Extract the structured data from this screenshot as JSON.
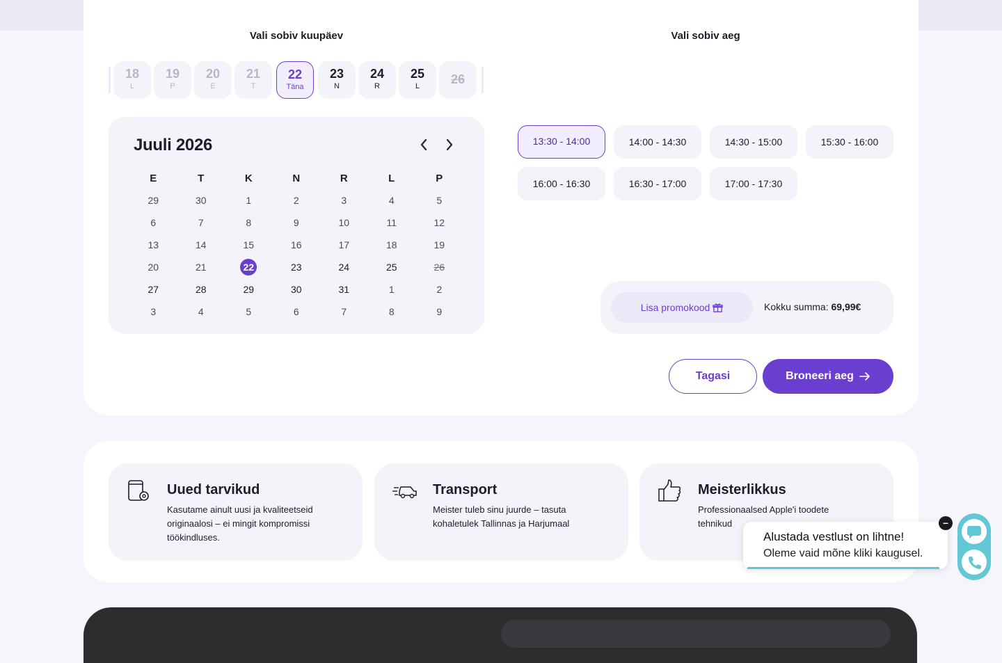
{
  "date_section": {
    "title": "Vali sobiv kuupäev"
  },
  "time_section": {
    "title": "Vali sobiv aeg"
  },
  "date_strip": [
    {
      "num": "18",
      "label": "L",
      "state": "past"
    },
    {
      "num": "19",
      "label": "P",
      "state": "past"
    },
    {
      "num": "20",
      "label": "E",
      "state": "past"
    },
    {
      "num": "21",
      "label": "T",
      "state": "past"
    },
    {
      "num": "22",
      "label": "Täna",
      "state": "today"
    },
    {
      "num": "23",
      "label": "N",
      "state": "available"
    },
    {
      "num": "24",
      "label": "R",
      "state": "available"
    },
    {
      "num": "25",
      "label": "L",
      "state": "available"
    },
    {
      "num": "26",
      "label": "",
      "state": "unavailable"
    }
  ],
  "calendar": {
    "title": "Juuli 2026",
    "prev_icon": "chevron-left-icon",
    "next_icon": "chevron-right-icon",
    "weekdays": [
      "E",
      "T",
      "K",
      "N",
      "R",
      "L",
      "P"
    ],
    "weeks": [
      [
        "29",
        "30",
        "1",
        "2",
        "3",
        "4",
        "5"
      ],
      [
        "6",
        "7",
        "8",
        "9",
        "10",
        "11",
        "12"
      ],
      [
        "13",
        "14",
        "15",
        "16",
        "17",
        "18",
        "19"
      ],
      [
        "20",
        "21",
        "22",
        "23",
        "24",
        "25",
        "26"
      ],
      [
        "27",
        "28",
        "29",
        "30",
        "31",
        "1",
        "2"
      ],
      [
        "3",
        "4",
        "5",
        "6",
        "7",
        "8",
        "9"
      ]
    ],
    "selected": "22",
    "available": [
      "23",
      "24",
      "25",
      "27",
      "28",
      "29",
      "30",
      "31"
    ],
    "struck": [
      "26"
    ]
  },
  "time_slots": [
    {
      "label": "13:30 - 14:00",
      "selected": true
    },
    {
      "label": "14:00 - 14:30",
      "selected": false
    },
    {
      "label": "14:30 - 15:00",
      "selected": false
    },
    {
      "label": "15:30 - 16:00",
      "selected": false
    },
    {
      "label": "16:00 - 16:30",
      "selected": false
    },
    {
      "label": "16:30 - 17:00",
      "selected": false
    },
    {
      "label": "17:00 - 17:30",
      "selected": false
    }
  ],
  "promo": {
    "button_label": "Lisa promokood",
    "icon": "gift-icon"
  },
  "total": {
    "label": "Kokku summa:",
    "value": "69,99€"
  },
  "actions": {
    "back_label": "Tagasi",
    "book_label": "Broneeri aeg",
    "book_icon": "arrow-right-icon"
  },
  "features": [
    {
      "icon": "device-settings-icon",
      "title": "Uued tarvikud",
      "text": "Kasutame ainult uusi ja kvaliteetseid originaalosi – ei mingit kompromissi töökindluses."
    },
    {
      "icon": "fast-car-icon",
      "title": "Transport",
      "text": "Meister tuleb sinu juurde – tasuta kohaletulek Tallinnas ja Harjumaal"
    },
    {
      "icon": "thumbs-up-icon",
      "title": "Meisterlikkus",
      "text": "Professionaalsed Apple'i toodete tehnikud"
    }
  ],
  "chat": {
    "line1": "Alustada vestlust on lihtne!",
    "line2": "Oleme vaid mõne kliki kaugusel.",
    "close_label": "–",
    "accent": "#64c7d6"
  },
  "colors": {
    "accent": "#6a3fd0",
    "card_bg": "#f4f3f9",
    "page_bg": "#f6f5fc"
  }
}
